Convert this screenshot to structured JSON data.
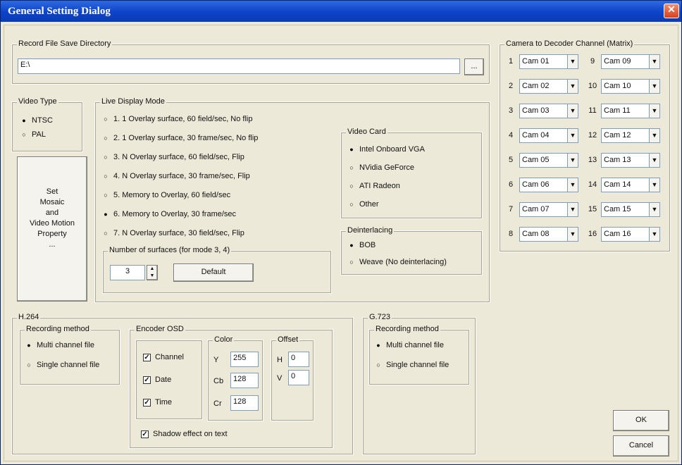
{
  "window": {
    "title": "General Setting Dialog",
    "close_glyph": "✕"
  },
  "record": {
    "label": "Record File Save Directory",
    "path": "E:\\",
    "browse": "..."
  },
  "video_type": {
    "label": "Video Type",
    "options": [
      {
        "label": "NTSC",
        "selected": true
      },
      {
        "label": "PAL",
        "selected": false
      }
    ]
  },
  "mosaic": {
    "lines": [
      "Set",
      "Mosaic",
      "and",
      "Video Motion",
      "Property",
      "..."
    ]
  },
  "live": {
    "label": "Live Display Mode",
    "options": [
      {
        "label": "1. 1 Overlay surface, 60 field/sec, No flip",
        "selected": false
      },
      {
        "label": "2. 1 Overlay surface, 30 frame/sec, No flip",
        "selected": false
      },
      {
        "label": "3. N Overlay surface, 60 field/sec, Flip",
        "selected": false
      },
      {
        "label": "4. N Overlay surface, 30 frame/sec, Flip",
        "selected": false
      },
      {
        "label": "5. Memory to Overlay, 60 field/sec",
        "selected": false
      },
      {
        "label": "6. Memory to Overlay, 30 frame/sec",
        "selected": true
      },
      {
        "label": "7. N Overlay surface, 30 field/sec, Flip",
        "selected": false
      }
    ],
    "surfaces": {
      "label": "Number of surfaces (for mode 3, 4)",
      "value": "3",
      "default": "Default"
    }
  },
  "video_card": {
    "label": "Video Card",
    "options": [
      {
        "label": "Intel Onboard VGA",
        "selected": true
      },
      {
        "label": "NVidia GeForce",
        "selected": false
      },
      {
        "label": "ATI Radeon",
        "selected": false
      },
      {
        "label": "Other",
        "selected": false
      }
    ]
  },
  "deinterlacing": {
    "label": "Deinterlacing",
    "options": [
      {
        "label": "BOB",
        "selected": true
      },
      {
        "label": "Weave (No deinterlacing)",
        "selected": false
      }
    ]
  },
  "matrix": {
    "label": "Camera to Decoder Channel (Matrix)",
    "left": [
      {
        "num": "1",
        "cam": "Cam 01"
      },
      {
        "num": "2",
        "cam": "Cam 02"
      },
      {
        "num": "3",
        "cam": "Cam 03"
      },
      {
        "num": "4",
        "cam": "Cam 04"
      },
      {
        "num": "5",
        "cam": "Cam 05"
      },
      {
        "num": "6",
        "cam": "Cam 06"
      },
      {
        "num": "7",
        "cam": "Cam 07"
      },
      {
        "num": "8",
        "cam": "Cam 08"
      }
    ],
    "right": [
      {
        "num": "9",
        "cam": "Cam 09"
      },
      {
        "num": "10",
        "cam": "Cam 10"
      },
      {
        "num": "11",
        "cam": "Cam 11"
      },
      {
        "num": "12",
        "cam": "Cam 12"
      },
      {
        "num": "13",
        "cam": "Cam 13"
      },
      {
        "num": "14",
        "cam": "Cam 14"
      },
      {
        "num": "15",
        "cam": "Cam 15"
      },
      {
        "num": "16",
        "cam": "Cam 16"
      }
    ]
  },
  "h264": {
    "label": "H.264",
    "recording": {
      "label": "Recording method",
      "options": [
        {
          "label": "Multi channel file",
          "selected": true
        },
        {
          "label": "Single channel file",
          "selected": false
        }
      ]
    },
    "osd": {
      "label": "Encoder OSD",
      "checks": [
        {
          "label": "Channel",
          "checked": true
        },
        {
          "label": "Date",
          "checked": true
        },
        {
          "label": "Time",
          "checked": true
        }
      ],
      "color": {
        "label": "Color",
        "fields": [
          {
            "name": "Y",
            "value": "255"
          },
          {
            "name": "Cb",
            "value": "128"
          },
          {
            "name": "Cr",
            "value": "128"
          }
        ]
      },
      "offset": {
        "label": "Offset",
        "fields": [
          {
            "name": "H",
            "value": "0"
          },
          {
            "name": "V",
            "value": "0"
          }
        ]
      },
      "shadow": {
        "label": "Shadow effect on text",
        "checked": true
      }
    }
  },
  "g723": {
    "label": "G.723",
    "recording": {
      "label": "Recording method",
      "options": [
        {
          "label": "Multi channel file",
          "selected": true
        },
        {
          "label": "Single channel file",
          "selected": false
        }
      ]
    }
  },
  "buttons": {
    "ok": "OK",
    "cancel": "Cancel"
  },
  "glyphs": {
    "radio_on": "●",
    "radio_off": "○",
    "check": "✓",
    "dropdown": "▼",
    "spin_up": "▲",
    "spin_down": "▼"
  }
}
